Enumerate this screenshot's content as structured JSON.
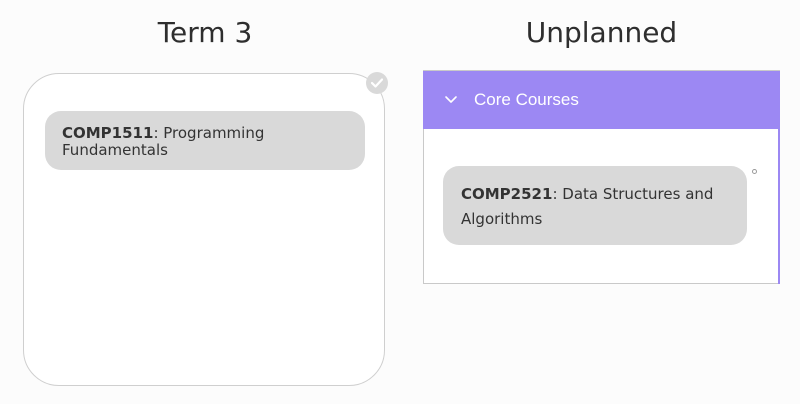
{
  "term_column": {
    "title": "Term 3",
    "courses": [
      {
        "code": "COMP1511",
        "name": "Programming Fundamentals"
      }
    ]
  },
  "unplanned_column": {
    "title": "Unplanned",
    "groups": [
      {
        "label": "Core Courses",
        "expanded": true,
        "courses": [
          {
            "code": "COMP2521",
            "name": "Data Structures and Algorithms"
          }
        ]
      }
    ]
  },
  "colors": {
    "accent": "#9c88f3",
    "card": "#d9d9d9",
    "text": "#333333"
  },
  "icons": {
    "check_badge": "check-circle-icon",
    "accordion_toggle": "chevron-down-icon"
  }
}
